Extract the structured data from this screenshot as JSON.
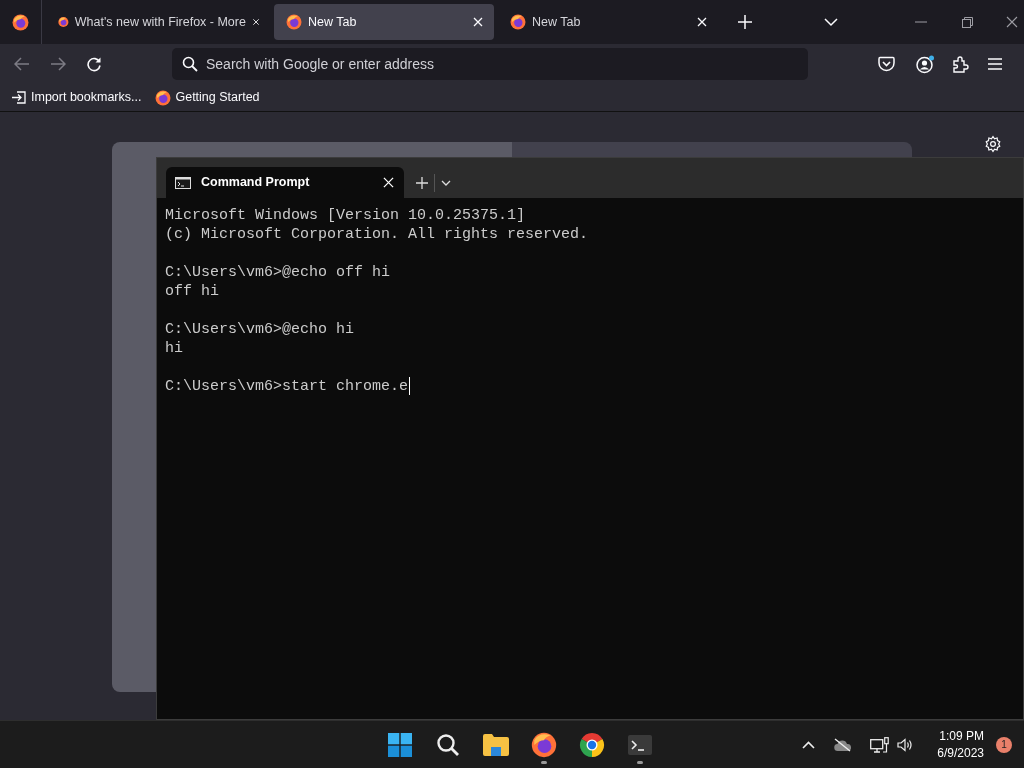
{
  "browser": {
    "tabs": [
      {
        "title": "What's new with Firefox - More",
        "selected": false
      },
      {
        "title": "New Tab",
        "selected": true
      },
      {
        "title": "New Tab",
        "selected": false
      }
    ],
    "address_bar": {
      "placeholder": "Search with Google or enter address"
    },
    "bookmarks": [
      {
        "kind": "import",
        "label": "Import bookmarks..."
      },
      {
        "kind": "page",
        "label": "Getting Started"
      }
    ]
  },
  "terminal": {
    "tabs": [
      {
        "title": "Command Prompt",
        "selected": true
      }
    ],
    "blocks": [
      [
        "Microsoft Windows [Version 10.0.25375.1]",
        "(c) Microsoft Corporation. All rights reserved."
      ],
      [
        "C:\\Users\\vm6>@echo off hi",
        "off hi"
      ],
      [
        "C:\\Users\\vm6>@echo hi",
        "hi"
      ],
      [
        "C:\\Users\\vm6>start chrome.e"
      ]
    ]
  },
  "taskbar": {
    "apps": [
      {
        "kind": "start",
        "running": false
      },
      {
        "kind": "search",
        "running": false
      },
      {
        "kind": "explorer",
        "running": false
      },
      {
        "kind": "firefox",
        "running": true
      },
      {
        "kind": "chrome",
        "running": false
      },
      {
        "kind": "terminal",
        "running": true
      }
    ],
    "time": "1:09 PM",
    "date": "6/9/2023",
    "notifications": "1"
  }
}
